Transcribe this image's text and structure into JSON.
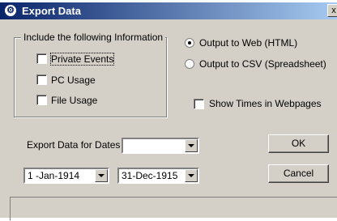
{
  "window": {
    "title": "Export Data",
    "icon": "gear-icon",
    "close_glyph": "x"
  },
  "group": {
    "title": "Include the following Information",
    "checkboxes": [
      {
        "label": "Private Events",
        "checked": false
      },
      {
        "label": "PC Usage",
        "checked": false
      },
      {
        "label": "File Usage",
        "checked": false
      }
    ]
  },
  "output": {
    "web_label": "Output to Web (HTML)",
    "csv_label": "Output to CSV (Spreadsheet)",
    "selected": "web"
  },
  "show_times_label": "Show Times in Webpages",
  "export_dates_label": "Export Data for Dates",
  "date_range_value": "",
  "from_date": "1 -Jan-1914",
  "to_date": "31-Dec-1915",
  "buttons": {
    "ok": "OK",
    "cancel": "Cancel"
  }
}
